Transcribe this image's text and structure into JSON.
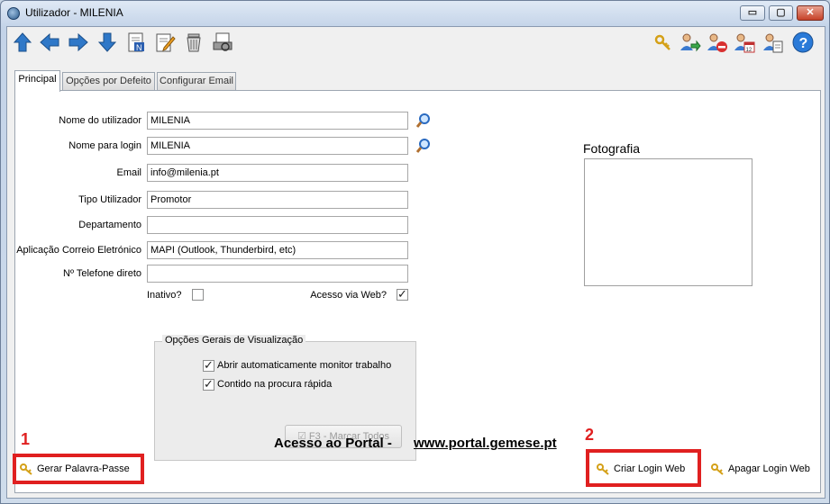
{
  "window": {
    "title": "Utilizador - MILENIA",
    "controls": {
      "minimize": "▭",
      "maximize": "▢",
      "close": "✕"
    }
  },
  "toolbar": {
    "left": [
      "arrow-up-icon",
      "arrow-left-icon",
      "arrow-right-icon",
      "arrow-down-icon",
      "new-document-icon",
      "edit-icon",
      "delete-icon",
      "print-preview-icon"
    ],
    "right": [
      "key-icon",
      "user-go-icon",
      "user-remove-icon",
      "user-calendar-icon",
      "user-report-icon",
      "help-icon"
    ]
  },
  "tabs": [
    {
      "label": "Principal",
      "active": true
    },
    {
      "label": "Opções por Defeito",
      "active": false
    },
    {
      "label": "Configurar Email",
      "active": false
    }
  ],
  "form": {
    "nome_utilizador": {
      "label": "Nome do utilizador",
      "value": "MILENIA"
    },
    "nome_login": {
      "label": "Nome para login",
      "value": "MILENIA"
    },
    "email": {
      "label": "Email",
      "value": "info@milenia.pt"
    },
    "tipo_utilizador": {
      "label": "Tipo Utilizador",
      "value": "Promotor"
    },
    "departamento": {
      "label": "Departamento",
      "value": ""
    },
    "correio": {
      "label": "Aplicação Correio Eletrónico",
      "value": "MAPI (Outlook, Thunderbird, etc)"
    },
    "telefone": {
      "label": "Nº Telefone direto",
      "value": ""
    },
    "inativo": {
      "label": "Inativo?",
      "checked": false
    },
    "acesso_web": {
      "label": "Acesso via Web?",
      "checked": true
    }
  },
  "options_group": {
    "title": "Opções Gerais de Visualização",
    "items": [
      {
        "label": "Abrir automaticamente monitor trabalho",
        "checked": true
      },
      {
        "label": "Contido na procura rápida",
        "checked": true
      }
    ],
    "button": "F3 - Marcar Todos"
  },
  "photo": {
    "label": "Fotografia"
  },
  "bottom": {
    "generate_password": "Gerar Palavra-Passe",
    "portal_text": "Acesso ao Portal  -",
    "portal_link": "www.portal.gemese.pt",
    "create_web_login": "Criar Login Web",
    "delete_web_login": "Apagar Login Web"
  },
  "annotations": {
    "marker_1": "1",
    "marker_2": "2",
    "color": "#e02020"
  }
}
